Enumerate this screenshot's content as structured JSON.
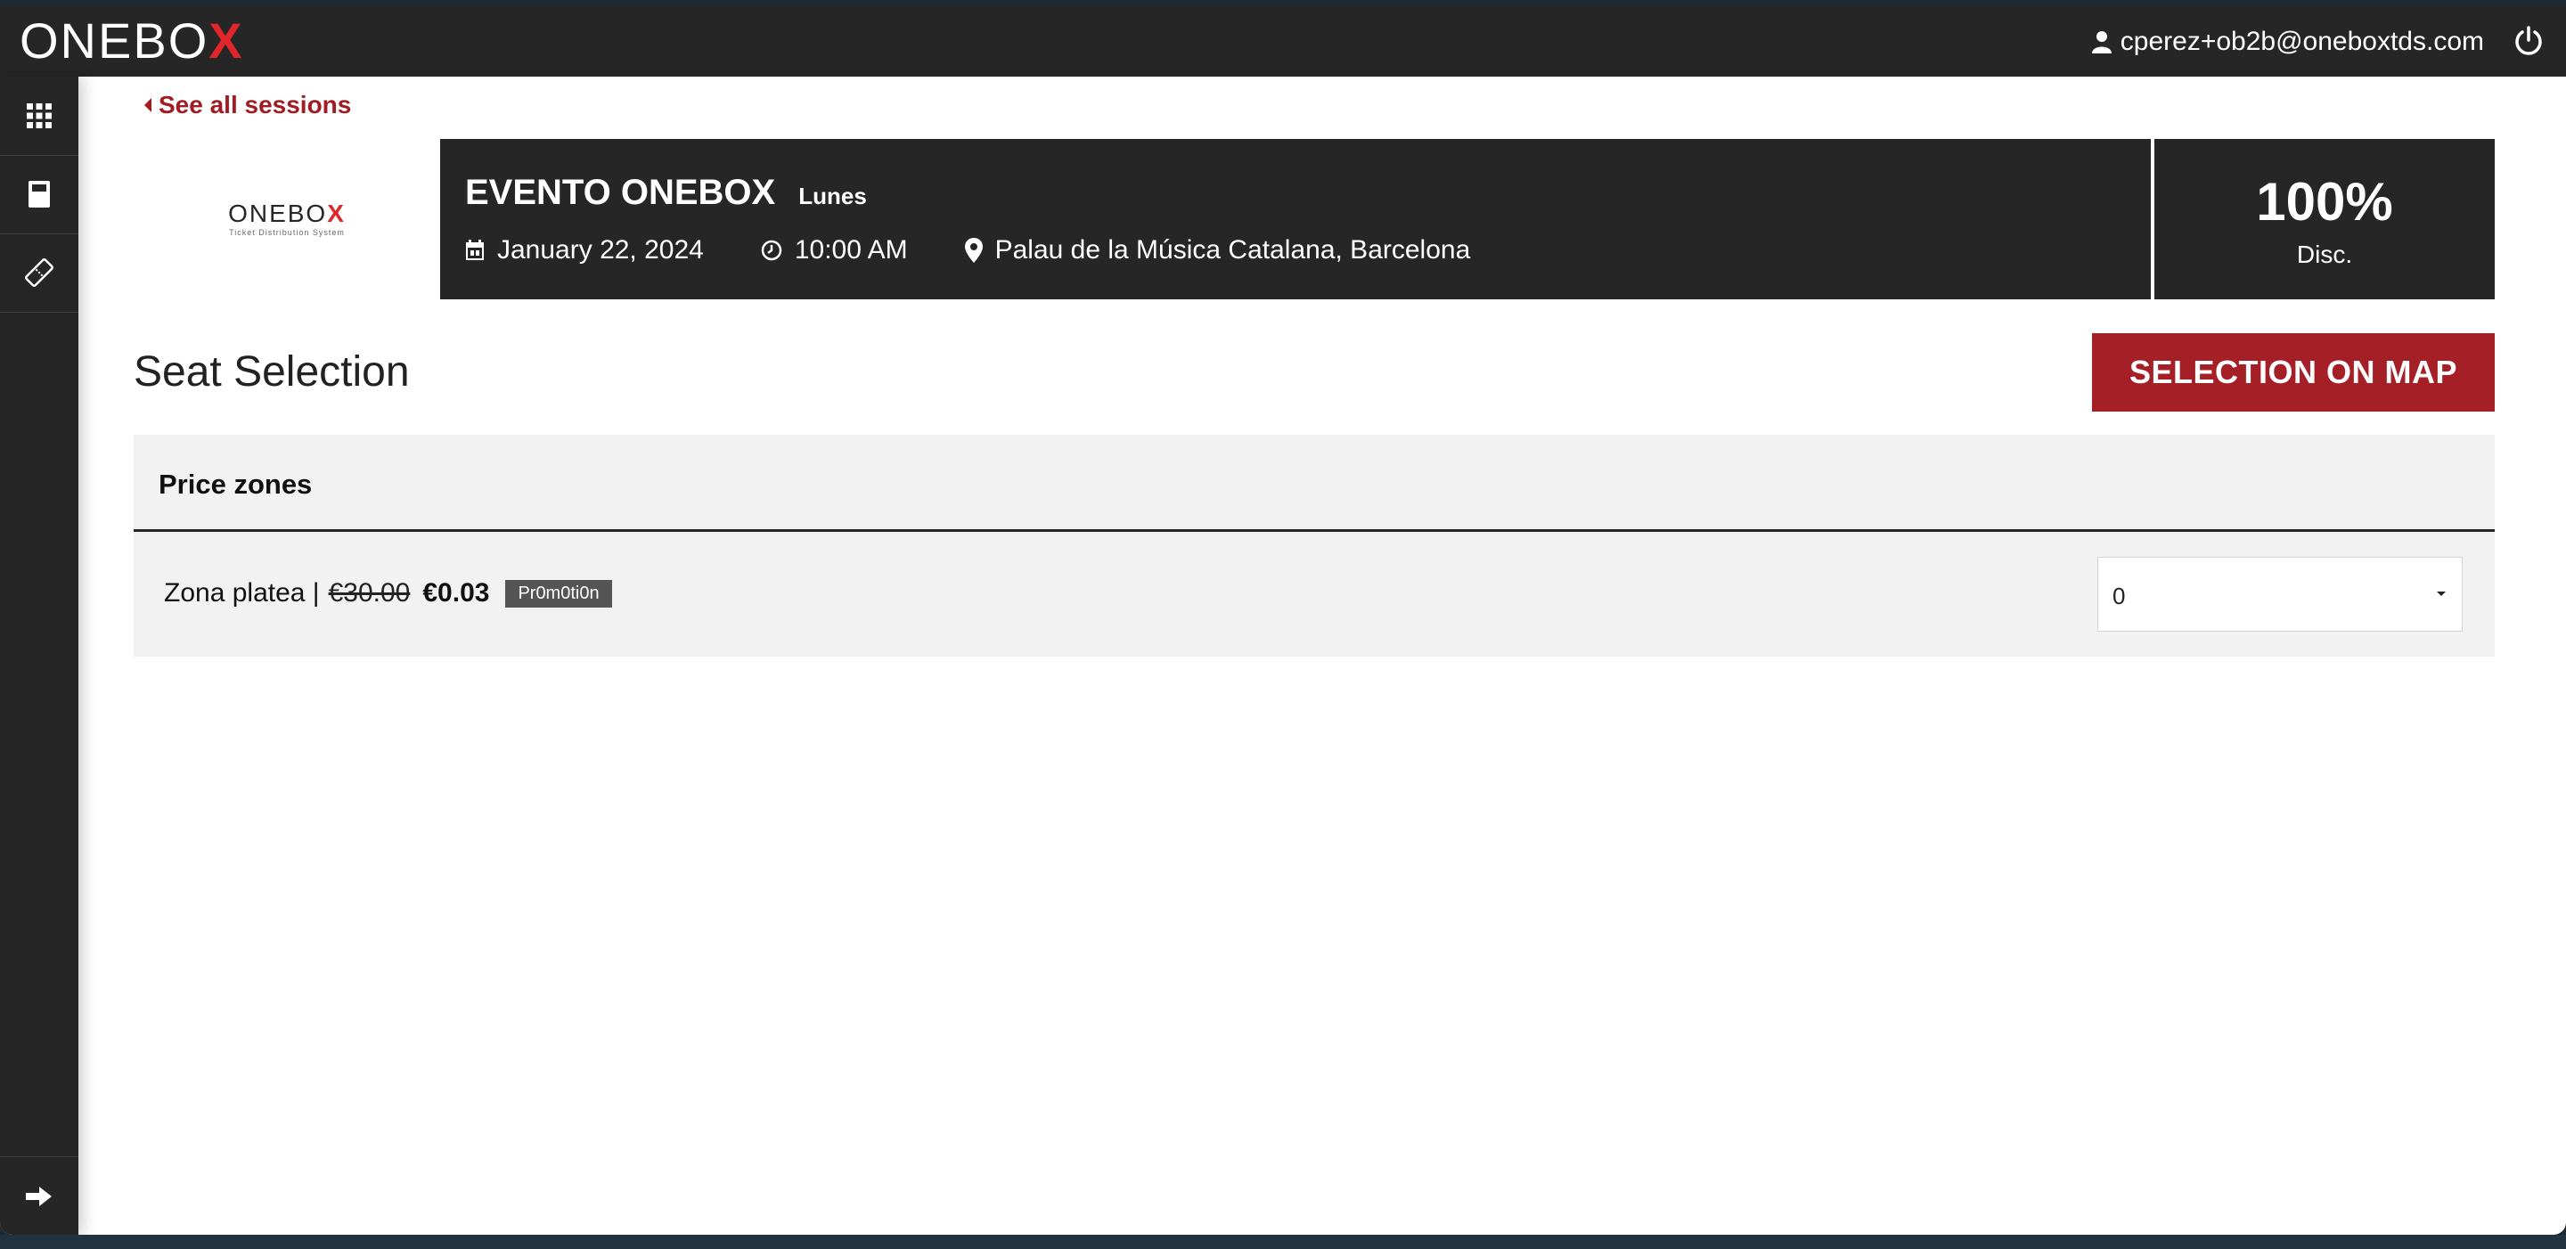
{
  "header": {
    "logo_main": "ONEBO",
    "logo_x": "X",
    "user_email": "cperez+ob2b@oneboxtds.com"
  },
  "sidebar": {
    "items": [
      {
        "icon": "grid-icon"
      },
      {
        "icon": "calculator-icon"
      },
      {
        "icon": "ticket-icon"
      },
      {
        "icon": "arrow-right-icon"
      }
    ]
  },
  "nav": {
    "back_label": "See all sessions"
  },
  "event": {
    "logo_main": "ONEBO",
    "logo_x": "X",
    "logo_tagline": "Ticket Distribution System",
    "title": "EVENTO ONEBOX",
    "subtitle": "Lunes",
    "date": "January 22, 2024",
    "time": "10:00 AM",
    "venue": "Palau de la Música Catalana, Barcelona",
    "discount_value": "100%",
    "discount_label": "Disc."
  },
  "page": {
    "title": "Seat Selection",
    "map_button": "SELECTION ON MAP"
  },
  "price_zones": {
    "header": "Price zones",
    "rows": [
      {
        "name": "Zona platea |",
        "old_price": "€30.00",
        "new_price": "€0.03",
        "badge": "Pr0m0ti0n",
        "quantity": "0"
      }
    ]
  },
  "colors": {
    "topbar": "#262626",
    "accent": "#a51f26",
    "logo_x": "#e0262a",
    "panel": "#f2f2f2"
  }
}
